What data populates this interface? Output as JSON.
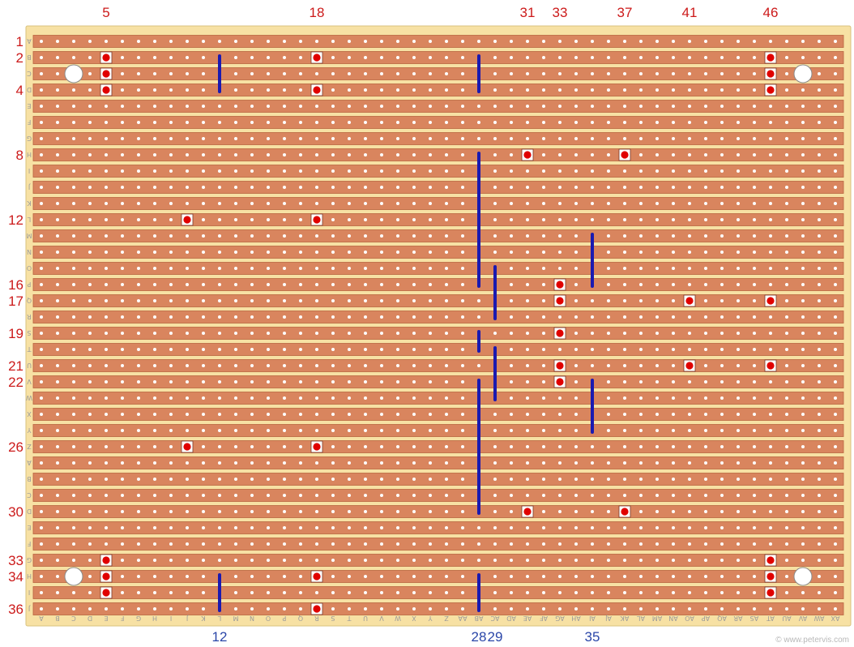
{
  "board": {
    "columns": 50,
    "rows": 36,
    "column_letters": [
      "A",
      "B",
      "C",
      "D",
      "E",
      "F",
      "G",
      "H",
      "I",
      "J",
      "K",
      "L",
      "M",
      "N",
      "O",
      "P",
      "Q",
      "R",
      "S",
      "T",
      "U",
      "V",
      "W",
      "X",
      "Y",
      "Z",
      "AA",
      "AB",
      "AC",
      "AD",
      "AE",
      "AF",
      "AG",
      "AH",
      "AI",
      "AJ",
      "AK",
      "AL",
      "AM",
      "AN",
      "AO",
      "AP",
      "AQ",
      "AR",
      "AS",
      "AT",
      "AU",
      "AV",
      "AW",
      "AX"
    ],
    "row_letters": [
      "A",
      "B",
      "C",
      "D",
      "E",
      "F",
      "G",
      "H",
      "I",
      "J",
      "K",
      "L",
      "M",
      "N",
      "O",
      "P",
      "Q",
      "R",
      "S",
      "T",
      "U",
      "V",
      "W",
      "X",
      "Y",
      "Z",
      "A",
      "B",
      "C",
      "D",
      "E",
      "F",
      "G",
      "H",
      "I",
      "J"
    ],
    "colors": {
      "board": "#f7e1a4",
      "strip": "#d9855e",
      "strip_edge": "#b8643f",
      "hole": "#ffffff",
      "pin_marker": "#e00000",
      "link_wire": "#1a1ab0",
      "mount_hole": "#ffffff"
    }
  },
  "labels": {
    "top_column_numbers": [
      5,
      18,
      31,
      33,
      37,
      41,
      46
    ],
    "bottom_column_numbers": [
      12,
      28,
      29,
      35
    ],
    "left_row_numbers": [
      1,
      2,
      4,
      8,
      12,
      16,
      17,
      19,
      21,
      22,
      26,
      30,
      33,
      34,
      36
    ]
  },
  "pins": [
    {
      "col": 5,
      "row": 2
    },
    {
      "col": 5,
      "row": 3
    },
    {
      "col": 5,
      "row": 4
    },
    {
      "col": 18,
      "row": 2
    },
    {
      "col": 18,
      "row": 4
    },
    {
      "col": 46,
      "row": 2
    },
    {
      "col": 46,
      "row": 3
    },
    {
      "col": 46,
      "row": 4
    },
    {
      "col": 31,
      "row": 8
    },
    {
      "col": 37,
      "row": 8
    },
    {
      "col": 10,
      "row": 12
    },
    {
      "col": 18,
      "row": 12
    },
    {
      "col": 33,
      "row": 16
    },
    {
      "col": 33,
      "row": 17
    },
    {
      "col": 41,
      "row": 17
    },
    {
      "col": 46,
      "row": 17
    },
    {
      "col": 33,
      "row": 19
    },
    {
      "col": 33,
      "row": 21
    },
    {
      "col": 41,
      "row": 21
    },
    {
      "col": 46,
      "row": 21
    },
    {
      "col": 33,
      "row": 22
    },
    {
      "col": 10,
      "row": 26
    },
    {
      "col": 18,
      "row": 26
    },
    {
      "col": 31,
      "row": 30
    },
    {
      "col": 37,
      "row": 30
    },
    {
      "col": 5,
      "row": 33
    },
    {
      "col": 46,
      "row": 33
    },
    {
      "col": 5,
      "row": 34
    },
    {
      "col": 18,
      "row": 34
    },
    {
      "col": 46,
      "row": 34
    },
    {
      "col": 5,
      "row": 35
    },
    {
      "col": 46,
      "row": 35
    },
    {
      "col": 18,
      "row": 36
    }
  ],
  "links": [
    {
      "col": 12,
      "from_row": 2,
      "to_row": 4
    },
    {
      "col": 28,
      "from_row": 2,
      "to_row": 4
    },
    {
      "col": 28,
      "from_row": 8,
      "to_row": 16
    },
    {
      "col": 35,
      "from_row": 13,
      "to_row": 16
    },
    {
      "col": 29,
      "from_row": 15,
      "to_row": 18
    },
    {
      "col": 28,
      "from_row": 19,
      "to_row": 20
    },
    {
      "col": 29,
      "from_row": 20,
      "to_row": 23
    },
    {
      "col": 28,
      "from_row": 22,
      "to_row": 30
    },
    {
      "col": 35,
      "from_row": 22,
      "to_row": 25
    },
    {
      "col": 12,
      "from_row": 34,
      "to_row": 36
    },
    {
      "col": 28,
      "from_row": 34,
      "to_row": 36
    }
  ],
  "mounting_holes": [
    {
      "col": 3,
      "row": 3
    },
    {
      "col": 48,
      "row": 3
    },
    {
      "col": 3,
      "row": 34
    },
    {
      "col": 48,
      "row": 34
    }
  ],
  "credit": "© www.petervis.com"
}
